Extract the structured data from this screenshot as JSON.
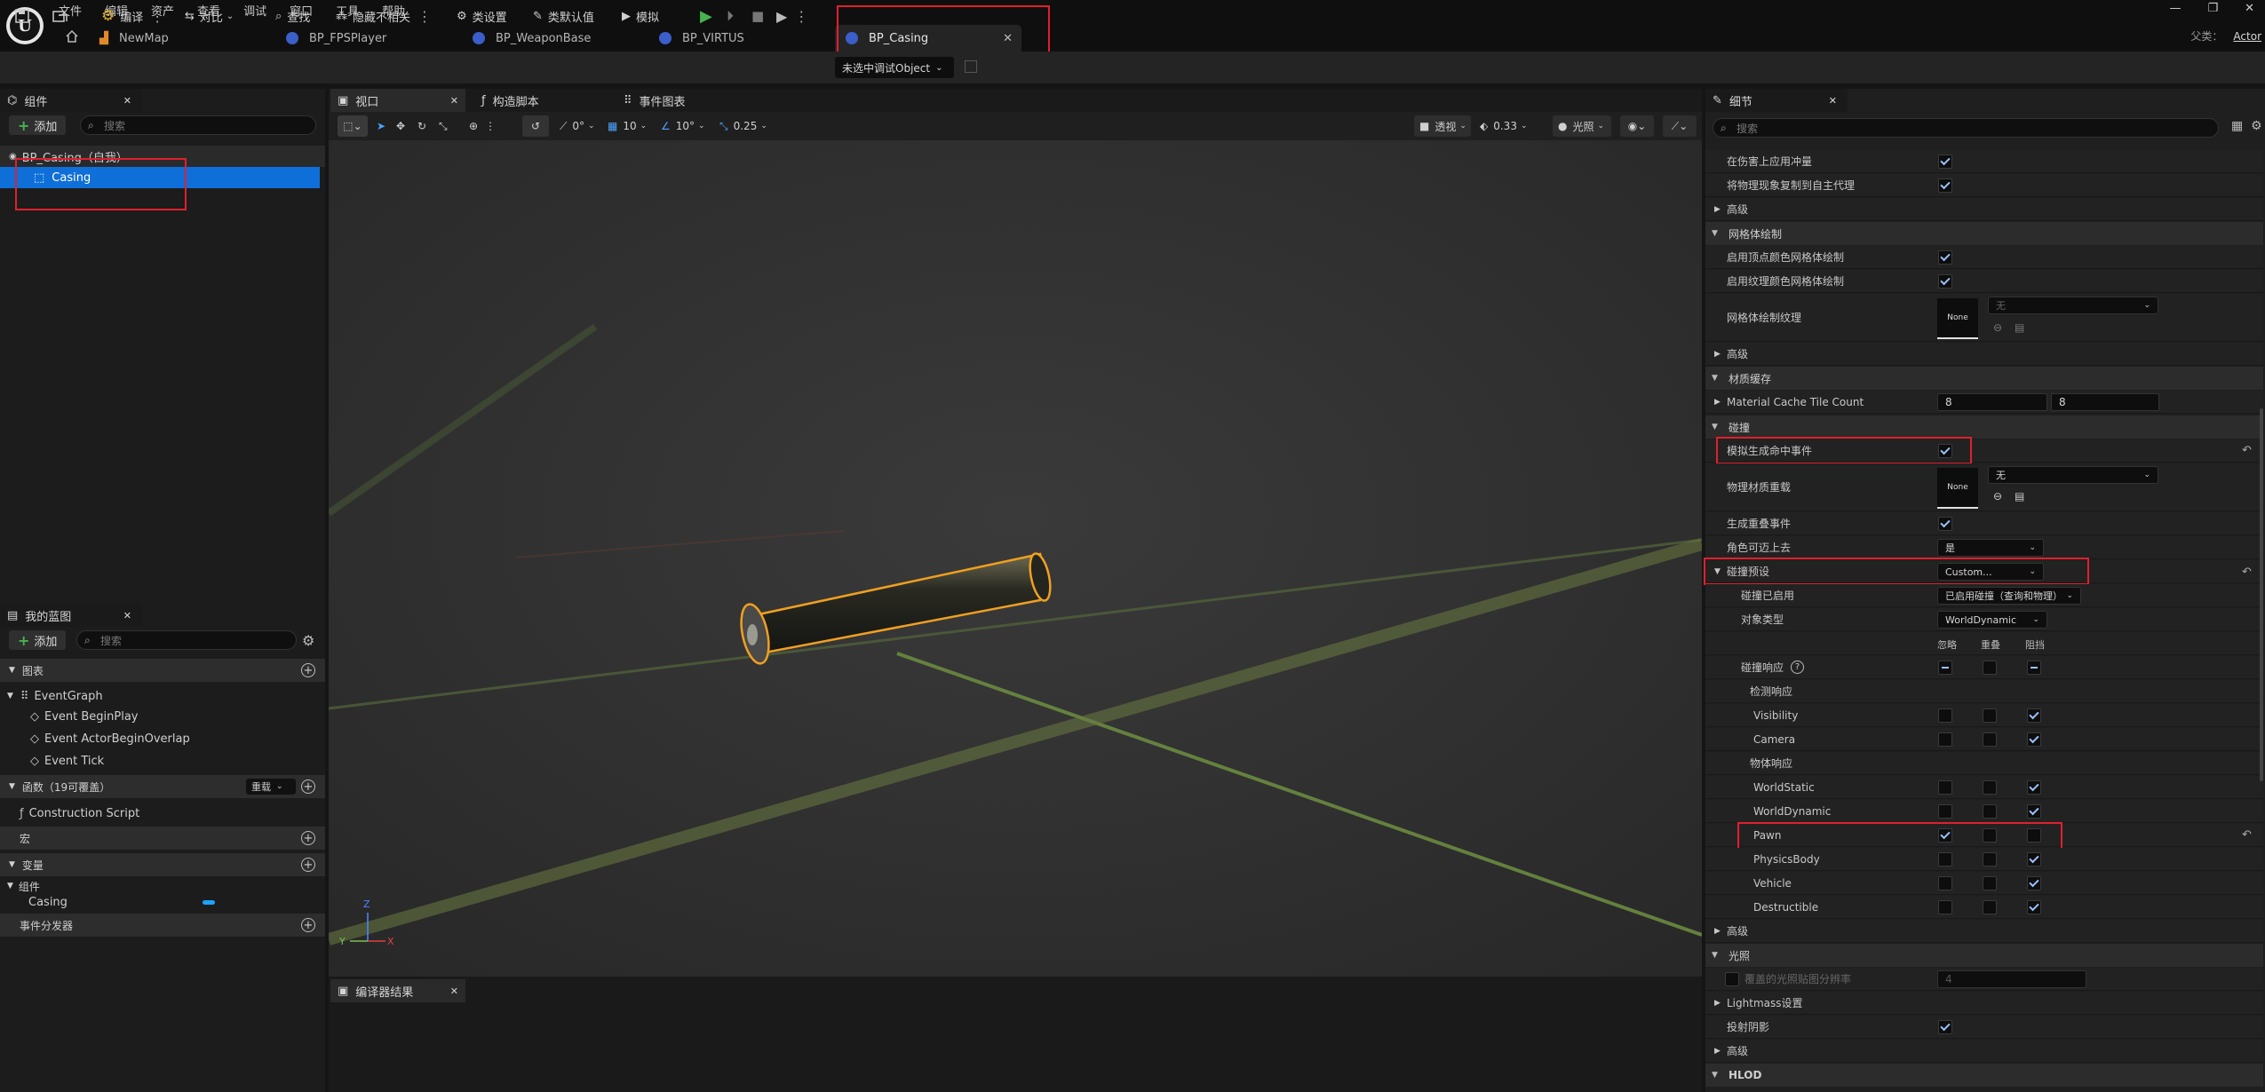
{
  "menu": [
    "文件",
    "编辑",
    "资产",
    "查看",
    "调试",
    "窗口",
    "工具",
    "帮助"
  ],
  "tabs": [
    {
      "label": "NewMap",
      "icon": "map-icon"
    },
    {
      "label": "BP_FPSPlayer",
      "icon": "blueprint-icon"
    },
    {
      "label": "BP_WeaponBase",
      "icon": "blueprint-icon"
    },
    {
      "label": "BP_VIRTUS",
      "icon": "blueprint-icon"
    },
    {
      "label": "BP_Casing",
      "icon": "blueprint-icon",
      "active": true
    }
  ],
  "tab_close": "✕",
  "parent_label": "父类：",
  "parent_value": "Actor",
  "toolbar": {
    "compile": "编译",
    "diff": "对比",
    "find": "查找",
    "hide_unrelated": "隐藏不相关",
    "class_settings": "类设置",
    "class_defaults": "类默认值",
    "simulate": "模拟",
    "debug_object": "未选中调试Object"
  },
  "components_panel": {
    "title": "组件",
    "add": "添加",
    "search_placeholder": "搜索",
    "root": "BP_Casing（自我）",
    "child": "Casing"
  },
  "blueprint_panel": {
    "title": "我的蓝图",
    "add": "添加",
    "search_placeholder": "搜索",
    "graph_section": "图表",
    "event_graph": "EventGraph",
    "events": [
      "Event BeginPlay",
      "Event ActorBeginOverlap",
      "Event Tick"
    ],
    "functions_section": "函数（19可覆盖）",
    "override_label": "重载",
    "construction_script": "Construction Script",
    "macros_section": "宏",
    "variables_section": "变量",
    "components_group": "组件",
    "component_var": "Casing",
    "dispatchers_section": "事件分发器"
  },
  "viewport": {
    "tabs": [
      "视口",
      "构造脚本",
      "事件图表"
    ],
    "rot_snap": "0°",
    "grid_snap": "10",
    "angle_snap": "10°",
    "scale_snap": "0.25",
    "view_mode": "透视",
    "fov": "0.33",
    "lit": "光照",
    "axis_z": "Z",
    "axis_y": "Y",
    "axis_x": "X"
  },
  "compiler_tab": "编译器结果",
  "details": {
    "title": "细节",
    "search_placeholder": "搜索",
    "rows": {
      "apply_impulse": "在伤害上应用冲量",
      "replicate_physics": "将物理现象复制到自主代理",
      "advanced": "高级",
      "mesh_paint": "网格体绘制",
      "vertex_color_paint": "启用顶点颜色网格体绘制",
      "texture_color_paint": "启用纹理颜色网格体绘制",
      "mesh_paint_texture": "网格体绘制纹理",
      "none": "None",
      "none_cn": "无",
      "material_cache": "材质缓存",
      "mat_cache_tile_count": "Material Cache Tile Count",
      "tile_x": "8",
      "tile_y": "8",
      "collision": "碰撞",
      "sim_hit_events": "模拟生成命中事件",
      "phys_material_override": "物理材质重载",
      "gen_overlap_events": "生成重叠事件",
      "can_step_up": "角色可迈上去",
      "can_step_up_value": "是",
      "collision_presets": "碰撞预设",
      "preset_value": "Custom...",
      "collision_enabled": "碰撞已启用",
      "collision_enabled_value": "已启用碰撞（查询和物理）",
      "object_type": "对象类型",
      "object_type_value": "WorldDynamic",
      "col_ignore": "忽略",
      "col_overlap": "重叠",
      "col_block": "阻挡",
      "collision_responses": "碰撞响应",
      "trace_responses": "检测响应",
      "visibility": "Visibility",
      "camera": "Camera",
      "object_responses": "物体响应",
      "world_static": "WorldStatic",
      "world_dynamic": "WorldDynamic",
      "pawn": "Pawn",
      "physics_body": "PhysicsBody",
      "vehicle": "Vehicle",
      "destructible": "Destructible",
      "lighting": "光照",
      "override_lightmap_res": "覆盖的光照贴图分辨率",
      "lightmap_res_value": "4",
      "lightmass_settings": "Lightmass设置",
      "cast_shadow": "投射阴影",
      "hlod": "HLOD"
    }
  },
  "colors": {
    "accent": "#0e6fd8",
    "highlight": "#e0202e",
    "play": "#47b34f",
    "selection_outline": "#f0a020"
  }
}
